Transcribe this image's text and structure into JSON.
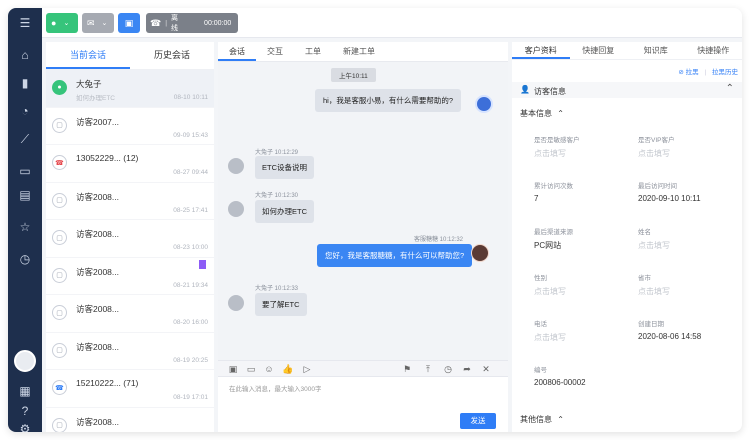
{
  "toolbar": {
    "phone_status": "离线",
    "phone_timer": "00:00:00"
  },
  "conversations": {
    "tab_current": "当前会话",
    "tab_history": "历史会话",
    "items": [
      {
        "name": "大兔子",
        "sub": "如何办理ETC",
        "time": "08-10 10:11",
        "icon": "wechat-icon",
        "selected": true,
        "flag": false
      },
      {
        "name": "访客2007...",
        "sub": "",
        "time": "09-09 15:43",
        "icon": "chat-icon",
        "selected": false,
        "flag": false
      },
      {
        "name": "13052229...  (12)",
        "sub": "",
        "time": "08-27 09:44",
        "icon": "phone-missed-icon",
        "selected": false,
        "flag": false
      },
      {
        "name": "访客2008...",
        "sub": "",
        "time": "08-25 17:41",
        "icon": "chat-icon",
        "selected": false,
        "flag": false
      },
      {
        "name": "访客2008...",
        "sub": "",
        "time": "08-23 10:00",
        "icon": "chat-icon",
        "selected": false,
        "flag": false
      },
      {
        "name": "访客2008...",
        "sub": "",
        "time": "08-21 19:34",
        "icon": "chat-icon",
        "selected": false,
        "flag": true
      },
      {
        "name": "访客2008...",
        "sub": "",
        "time": "08-20 16:00",
        "icon": "chat-icon",
        "selected": false,
        "flag": false
      },
      {
        "name": "访客2008...",
        "sub": "",
        "time": "08-19 20:25",
        "icon": "chat-icon",
        "selected": false,
        "flag": false
      },
      {
        "name": "15210222...  (71)",
        "sub": "",
        "time": "08-19 17:01",
        "icon": "phone-icon",
        "selected": false,
        "flag": false
      },
      {
        "name": "访客2008...",
        "sub": "",
        "time": "",
        "icon": "chat-icon",
        "selected": false,
        "flag": false
      }
    ]
  },
  "chat": {
    "tabs": [
      "会话",
      "交互",
      "工单",
      "新建工单"
    ],
    "time_divider": "上午10:11",
    "messages": [
      {
        "from": "agent",
        "text": "hi，我是客服小易，有什么需要帮助的?",
        "meta": ""
      },
      {
        "from": "user",
        "text": "ETC设备说明",
        "meta": "大兔子 10:12:29"
      },
      {
        "from": "user",
        "text": "如何办理ETC",
        "meta": "大兔子 10:12:30"
      },
      {
        "from": "agent",
        "text": "您好，我是客服糖糖，有什么可以帮助您?",
        "meta": "客服糖糖 10:12:32"
      },
      {
        "from": "user",
        "text": "要了解ETC",
        "meta": "大兔子 10:12:33"
      }
    ],
    "composer_placeholder": "在此输入消息，最大输入3000字",
    "send_label": "发送"
  },
  "right": {
    "tabs": [
      "客户资料",
      "快捷回复",
      "知识库",
      "快捷操作"
    ],
    "link_blacklist": "拉黑",
    "link_history": "拉黑历史",
    "section_title": "访客信息",
    "basic_title": "基本信息",
    "other_title": "其他信息",
    "fields": [
      {
        "label": "是否是敏感客户",
        "value": "点击填写",
        "placeholder": true
      },
      {
        "label": "是否VIP客户",
        "value": "点击填写",
        "placeholder": true
      },
      {
        "label": "累计访问次数",
        "value": "7",
        "placeholder": false
      },
      {
        "label": "最后访问时间",
        "value": "2020-09-10 10:11",
        "placeholder": false
      },
      {
        "label": "最后渠道来源",
        "value": "PC网站",
        "placeholder": false
      },
      {
        "label": "姓名",
        "value": "点击填写",
        "placeholder": true
      },
      {
        "label": "性别",
        "value": "点击填写",
        "placeholder": true
      },
      {
        "label": "省市",
        "value": "点击填写",
        "placeholder": true
      },
      {
        "label": "电话",
        "value": "点击填写",
        "placeholder": true
      },
      {
        "label": "创建日期",
        "value": "2020-08-06 14:58",
        "placeholder": false
      },
      {
        "label": "编号",
        "value": "200806-00002",
        "placeholder": false
      }
    ]
  },
  "colors": {
    "accent": "#2f7df6",
    "sidebar": "#1e2f4d",
    "green_button": "#36c47b",
    "grey_button": "#a6aab2",
    "blue_button": "#3a86f3",
    "flag": "#8d5cf6"
  }
}
